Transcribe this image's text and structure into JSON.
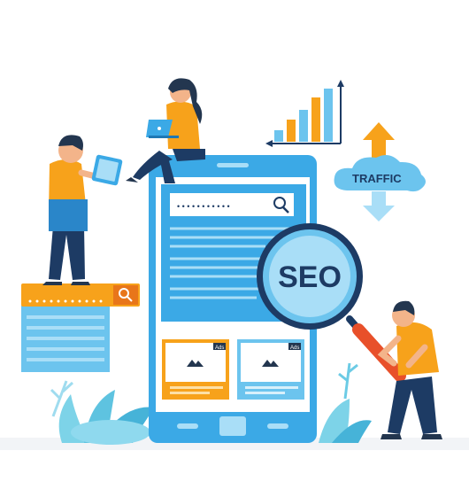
{
  "illustration": {
    "traffic_label": "TRAFFIC",
    "seo_label": "SEO",
    "ad_badge": "Ads",
    "search_placeholder_dots": "• • • • • • • • • • •",
    "colors": {
      "blue_primary": "#3ba9e6",
      "blue_light": "#a9def7",
      "blue_dark": "#1f78b4",
      "orange": "#f7a21b",
      "orange_dark": "#e8761a",
      "navy": "#1d3b64",
      "skin": "#f3b48a",
      "hair": "#23364f"
    }
  }
}
